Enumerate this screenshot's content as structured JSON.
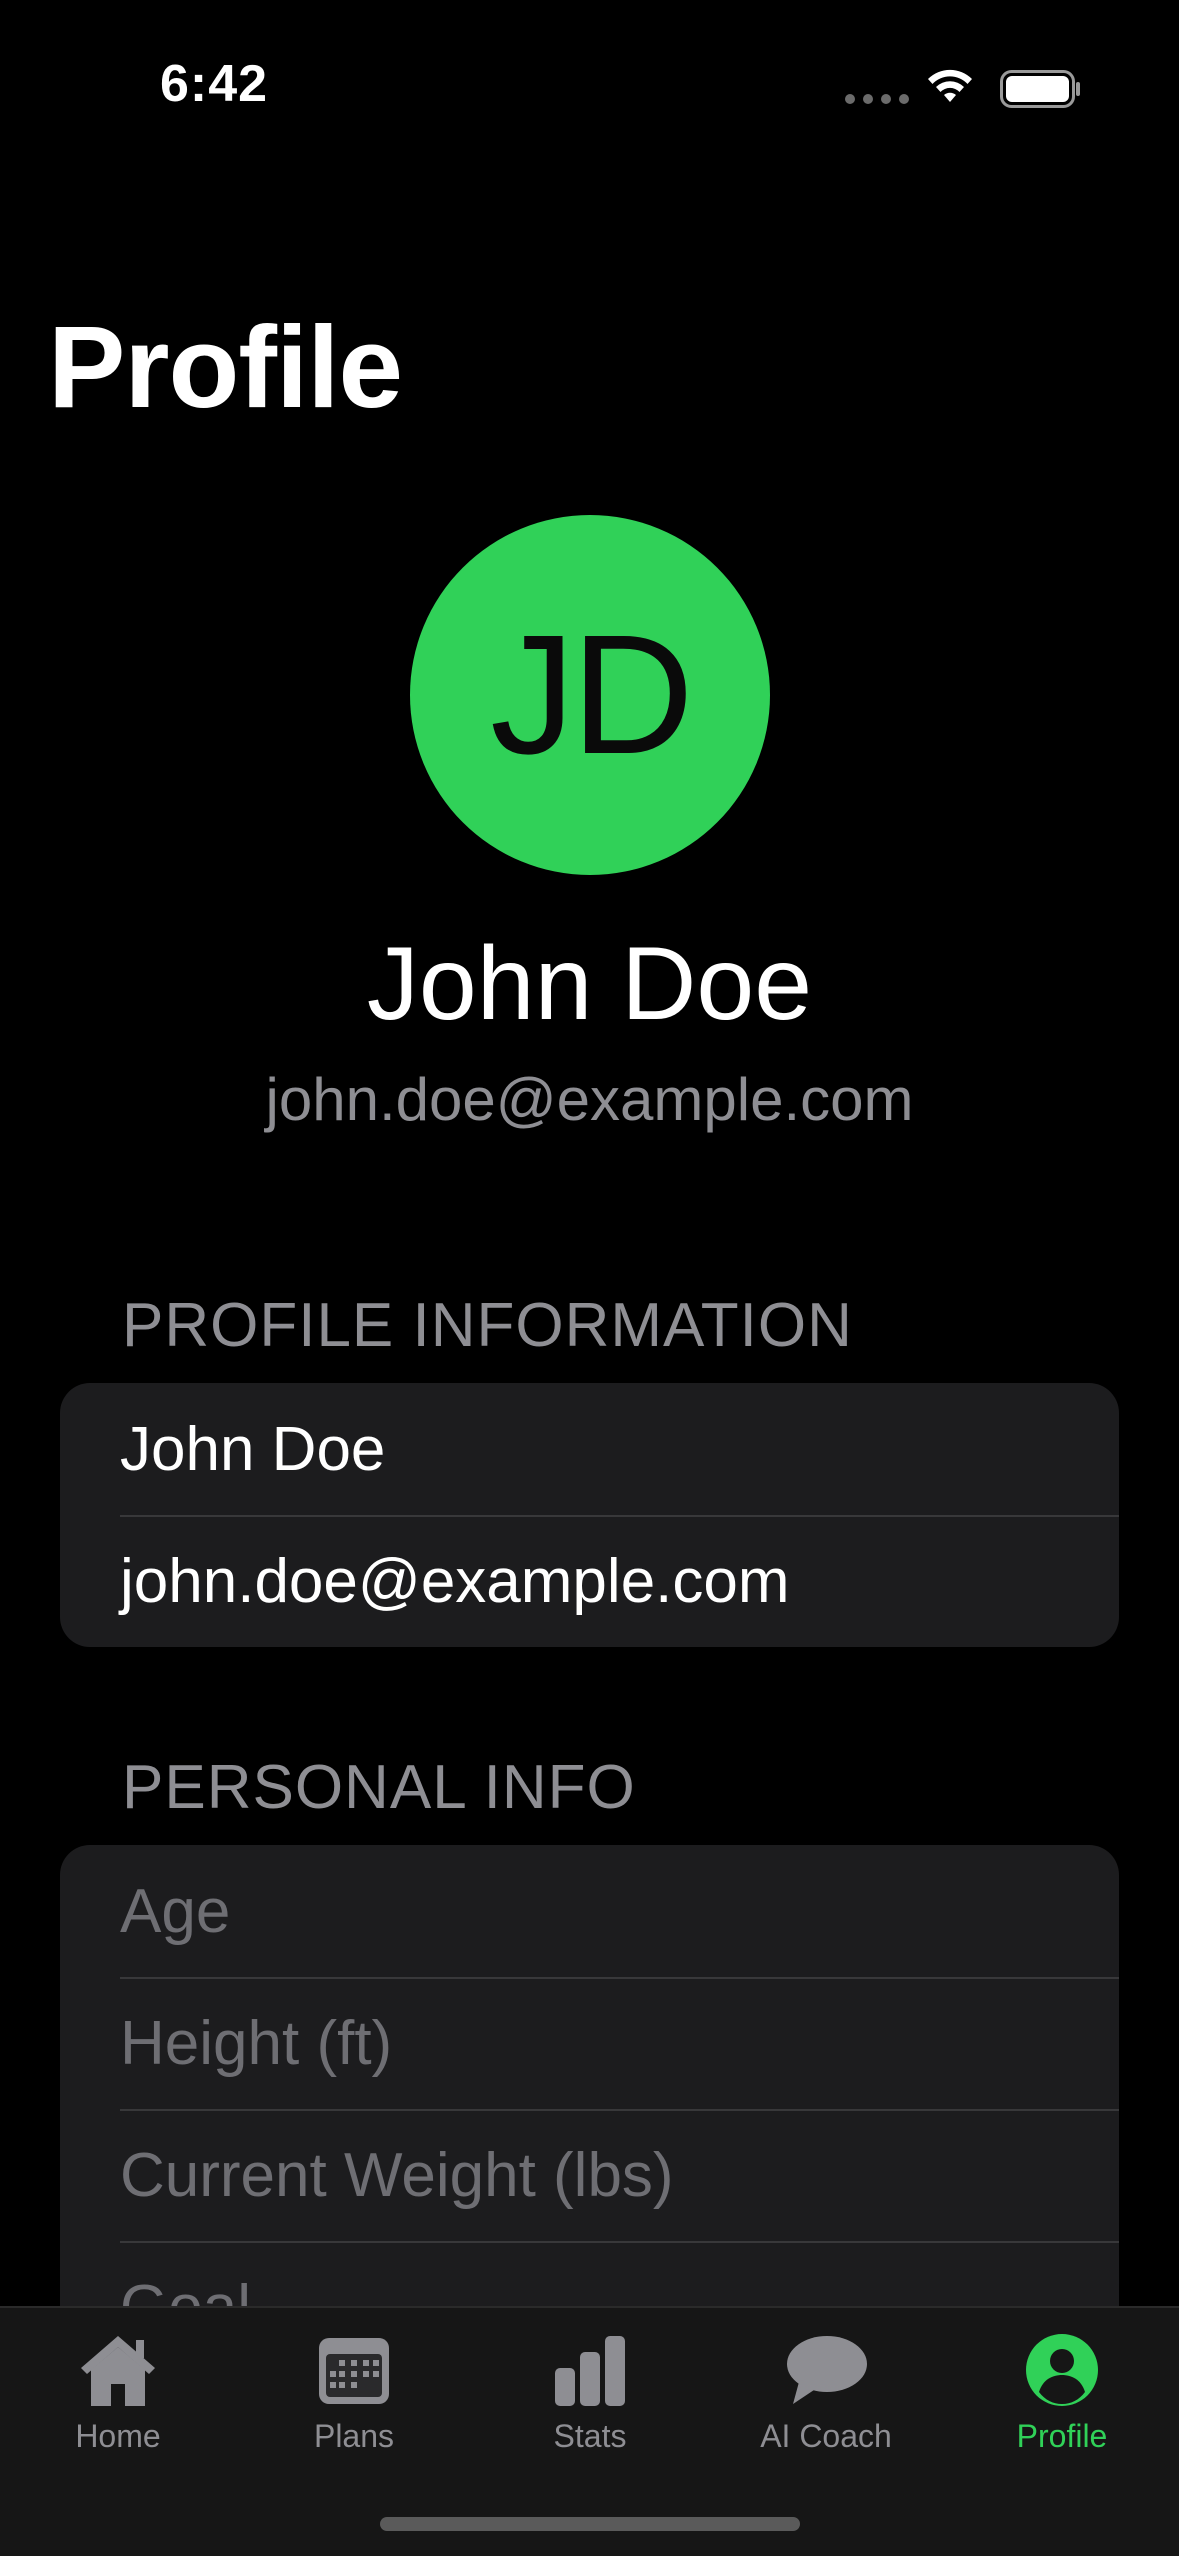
{
  "status_bar": {
    "time": "6:42"
  },
  "page": {
    "title": "Profile"
  },
  "profile": {
    "initials": "JD",
    "name": "John Doe",
    "email": "john.doe@example.com",
    "avatar_color": "#30d158"
  },
  "profile_information": {
    "header": "PROFILE INFORMATION",
    "name_value": "John Doe",
    "email_value": "john.doe@example.com"
  },
  "personal_info": {
    "header": "PERSONAL INFO",
    "fields": [
      {
        "placeholder": "Age"
      },
      {
        "placeholder": "Height (ft)"
      },
      {
        "placeholder": "Current Weight (lbs)"
      },
      {
        "placeholder": "Goal"
      }
    ]
  },
  "tab_bar": {
    "tabs": [
      {
        "label": "Home",
        "icon": "house-icon"
      },
      {
        "label": "Plans",
        "icon": "calendar-icon"
      },
      {
        "label": "Stats",
        "icon": "bar-chart-icon"
      },
      {
        "label": "AI Coach",
        "icon": "chat-bubble-icon"
      },
      {
        "label": "Profile",
        "icon": "person-circle-icon"
      }
    ],
    "active": "Profile",
    "active_color": "#30d158",
    "inactive_color": "#8e8e93"
  }
}
